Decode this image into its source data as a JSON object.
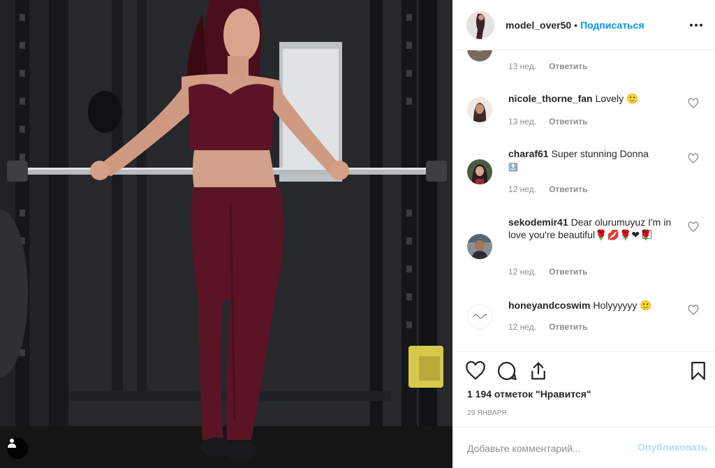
{
  "post": {
    "username": "model_over50",
    "separator": "•",
    "follow_label": "Подписаться",
    "more_icon": "more-horizontal-icon"
  },
  "comments": [
    {
      "username": "",
      "text": "",
      "time": "13 нед.",
      "reply": "Ответить"
    },
    {
      "username": "nicole_thorne_fan",
      "text": "Lovely 🙂",
      "time": "13 нед.",
      "reply": "Ответить"
    },
    {
      "username": "charaf61",
      "text": "Super stunning Donna",
      "text2": "🔝",
      "time": "12 нед.",
      "reply": "Ответить"
    },
    {
      "username": "sekodemir41",
      "text": "Dear olurumuyuz I'm in love you're beautiful🌹💋🌹❤🌹⃞⃞",
      "time": "12 нед.",
      "reply": "Ответить"
    },
    {
      "username": "honeyandcoswim",
      "text": "Holyyyyyy 🙂",
      "time": "12 нед.",
      "reply": "Ответить"
    }
  ],
  "actions": {
    "likes": "1 194 отметок \"Нравится\"",
    "date": "29 ЯНВАРЯ"
  },
  "composer": {
    "placeholder": "Добавьте комментарий...",
    "publish_label": "Опубликовать"
  },
  "colors": {
    "link_blue": "#0095f6",
    "publish_disabled": "#b2dffc",
    "muted": "#8e8e8e",
    "text": "#262626",
    "outfit": "#5a1426"
  }
}
